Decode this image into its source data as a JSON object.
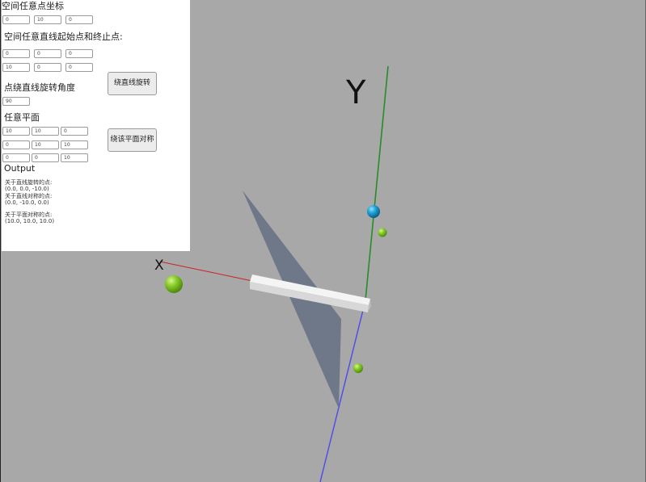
{
  "panel": {
    "point_title": "空间任意点坐标",
    "point": [
      "0",
      "10",
      "0"
    ],
    "line_title": "空间任意直线起始点和终止点:",
    "line_start": [
      "0",
      "0",
      "0"
    ],
    "line_end": [
      "10",
      "0",
      "0"
    ],
    "rotate_button": "绕直线旋转",
    "angle_title": "点绕直线旋转角度",
    "angle": "90",
    "plane_title": "任意平面",
    "plane_row1": [
      "10",
      "10",
      "0"
    ],
    "plane_row2": [
      "0",
      "10",
      "10"
    ],
    "plane_row3": [
      "0",
      "0",
      "10"
    ],
    "mirror_button": "绕该平面对称",
    "output_title": "Output",
    "out_rotate_label": "关于直线旋转的点:",
    "out_rotate_value": "(0.0, 0.0, -10.0)",
    "out_mirror_line_label": "关于直线对称的点:",
    "out_mirror_line_value": "(0.0, -10.0, 0.0)",
    "out_mirror_plane_label": "关于平面对称的点:",
    "out_mirror_plane_value": "(10.0, 10.0, 10.0)"
  },
  "scene": {
    "y_axis_label": "Y",
    "x_axis_label": "X",
    "colors": {
      "background": "#a8a8a8",
      "x_axis": "#cc2222",
      "y_axis": "#2a8a2a",
      "z_axis": "#4a4aee",
      "sphere_green": "#7ec823",
      "sphere_blue": "#1c9ed0",
      "plane": "#6f7888",
      "bar": "#f2f2f2"
    }
  }
}
